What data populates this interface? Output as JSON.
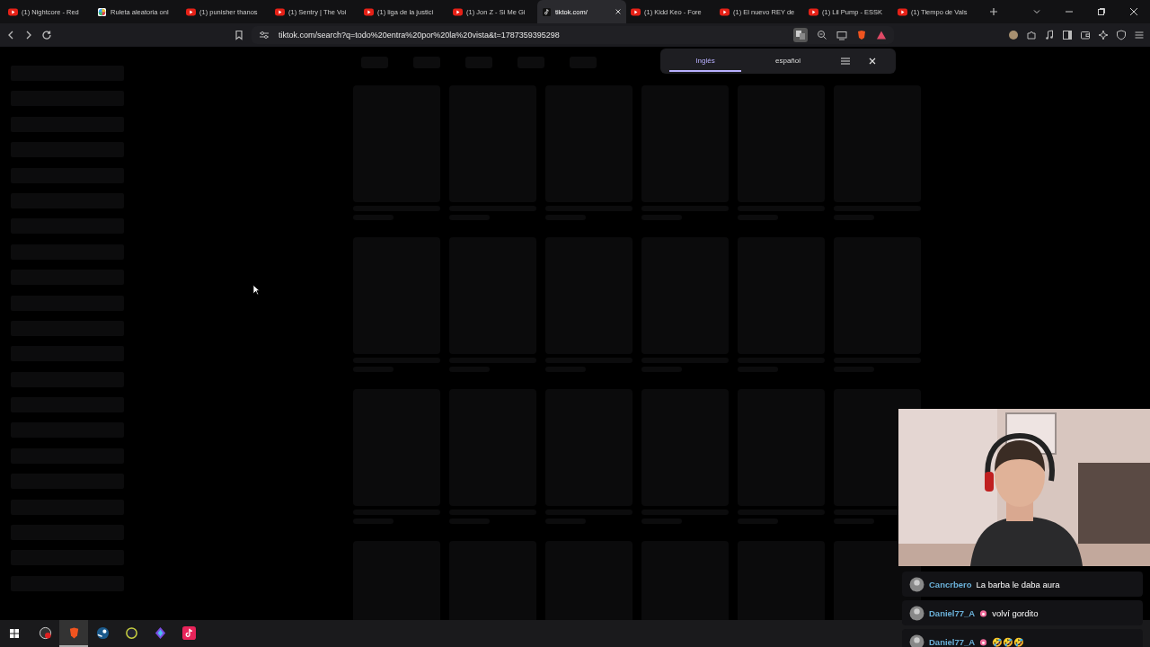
{
  "tabs": [
    {
      "kind": "youtube",
      "title": "(1) Nightcore - Red",
      "selected": false
    },
    {
      "kind": "wheel",
      "title": "Ruleta aleatoria onl",
      "selected": false
    },
    {
      "kind": "youtube",
      "title": "(1) punisher thanos",
      "selected": false
    },
    {
      "kind": "youtube",
      "title": "(1) Sentry | The Voi",
      "selected": false
    },
    {
      "kind": "youtube",
      "title": "(1) liga de la justici",
      "selected": false
    },
    {
      "kind": "youtube",
      "title": "(1) Jon Z - Si Me Gi",
      "selected": false
    },
    {
      "kind": "tiktok",
      "title": "tiktok.com/",
      "selected": true
    },
    {
      "kind": "youtube",
      "title": "(1) Kidd Keo - Fore",
      "selected": false
    },
    {
      "kind": "youtube",
      "title": "(1) El nuevo REY de",
      "selected": false
    },
    {
      "kind": "youtube",
      "title": "(1) Lil Pump - ESSK",
      "selected": false
    },
    {
      "kind": "youtube",
      "title": "(1) Tiempo de Vals",
      "selected": false
    }
  ],
  "address": {
    "url": "tiktok.com/search?q=todo%20entra%20por%20la%20vista&t=1787359395298"
  },
  "translate": {
    "languages": [
      {
        "label": "Inglés",
        "selected": true
      },
      {
        "label": "español",
        "selected": false
      }
    ]
  },
  "chat": [
    {
      "user": "Cancrbero",
      "badge": false,
      "text": "La barba le daba aura"
    },
    {
      "user": "Daniel77_A",
      "badge": true,
      "text": "volví gordito"
    },
    {
      "user": "Daniel77_A",
      "badge": true,
      "text": "🤣🤣🤣"
    }
  ],
  "taskbar": [
    {
      "kind": "obs",
      "selected": false
    },
    {
      "kind": "brave",
      "selected": true
    },
    {
      "kind": "steam",
      "selected": false
    },
    {
      "kind": "game",
      "selected": false
    },
    {
      "kind": "diamond",
      "selected": false
    },
    {
      "kind": "tiktok",
      "selected": false
    }
  ]
}
